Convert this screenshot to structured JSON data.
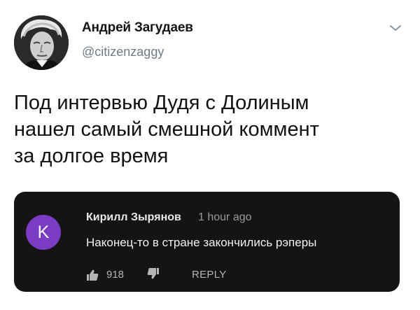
{
  "tweet": {
    "author_name": "Андрей Загудаев",
    "author_handle": "@citizenzaggy",
    "text_lines": [
      "Под интервью Дудя с Долиным",
      "нашел самый смешной коммент",
      "за долгое время"
    ],
    "menu_icon": "chevron-down-icon"
  },
  "youtube_comment": {
    "avatar_letter": "K",
    "avatar_color": "#7b3cc4",
    "author": "Кирилл Зырянов",
    "time": "1 hour ago",
    "text": "Наконец-то в стране закончились рэперы",
    "likes": "918",
    "reply_label": "REPLY",
    "like_icon": "thumbs-up-icon",
    "dislike_icon": "thumbs-down-icon"
  }
}
